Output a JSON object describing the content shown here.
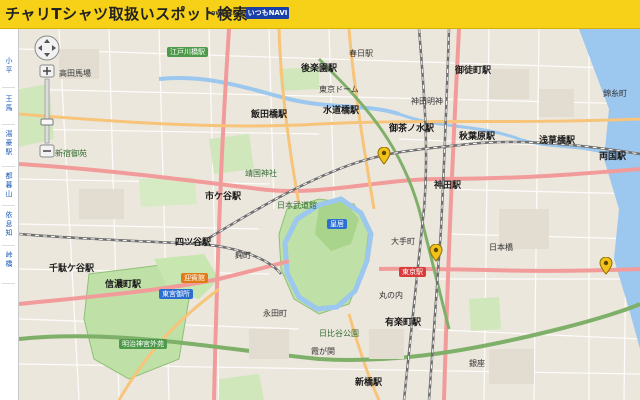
{
  "header": {
    "title": "チャリTシャツ取扱いスポット検索",
    "powered_by": "POWERED BY",
    "brand": "いつもNAVI"
  },
  "sidebar": {
    "items": [
      {
        "lines": [
          "小",
          "平"
        ]
      },
      {
        "lines": [
          "王",
          "馬"
        ]
      },
      {
        "lines": [
          "湯",
          "豪",
          "駅"
        ]
      },
      {
        "lines": [
          "都",
          "暮",
          "山"
        ]
      },
      {
        "lines": [
          "依",
          "息",
          "知"
        ]
      },
      {
        "lines": [
          "峠",
          "橋"
        ]
      }
    ]
  },
  "map": {
    "labels": {
      "edogawabashi": "江戸川橋駅",
      "takadanobaba": "高田馬場",
      "korakuen": "後楽園駅",
      "kasuga": "春日駅",
      "okachimachi": "御徒町駅",
      "iidabashi": "飯田橋駅",
      "suidobashi": "水道橋駅",
      "ochanomizu": "御茶ノ水駅",
      "akihabara": "秋葉原駅",
      "asakusabashi": "浅草橋駅",
      "ryogoku": "両国駅",
      "ichigaya": "市ケ谷駅",
      "kanda": "神田駅",
      "yotsuya": "四ツ谷駅",
      "sendagaya": "千駄ケ谷駅",
      "shinanomachi": "信濃町駅",
      "tokyo": "東京駅",
      "yurakucho": "有楽町駅",
      "shinbashi": "新橋駅",
      "akasaka_gosho": "迎賓館",
      "togu_gosho": "東宮御所",
      "kokyo": "皇居",
      "meiji_jingu": "明治神宮外苑",
      "kinshicho": "錦糸町",
      "yasukuni": "靖国神社",
      "nihonbashi": "日本橋",
      "tokyo_dome": "東京ドーム",
      "kanda_myojin": "神田明神",
      "budokan": "日本武道館",
      "shinjuku_gyoen": "新宿御苑",
      "kojimachi": "麹町",
      "nagatacho": "永田町",
      "kasumigaseki": "霞が関",
      "ginza": "銀座",
      "marunouchi": "丸の内",
      "otemachi": "大手町",
      "hibiya": "日比谷公園"
    },
    "spots": [
      {
        "name": "spot-1"
      },
      {
        "name": "spot-2"
      },
      {
        "name": "spot-3"
      }
    ],
    "colors": {
      "land": "#ece7dc",
      "park": "#bfe0a6",
      "water": "#9cc7ee",
      "rail": "#7a7a7a",
      "major_road": "#f29b9b",
      "marker": "#f3c21a"
    }
  }
}
